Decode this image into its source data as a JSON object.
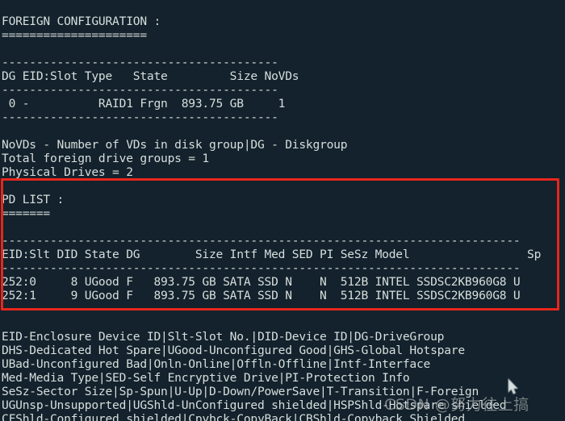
{
  "terminal": {
    "background_color": "#13222c",
    "text_color": "#d7dedd",
    "highlight_color": "#e8261c",
    "lines": [
      "FOREIGN CONFIGURATION :",
      "=====================",
      "",
      "----------------------------------------",
      "DG EID:Slot Type   State         Size NoVDs",
      "----------------------------------------",
      " 0 -          RAID1 Frgn  893.75 GB     1",
      "----------------------------------------",
      "",
      "NoVDs - Number of VDs in disk group|DG - Diskgroup",
      "Total foreign drive groups = 1",
      "Physical Drives = 2",
      "",
      "PD LIST :",
      "=======",
      "",
      "---------------------------------------------------------------------------",
      "EID:Slt DID State DG        Size Intf Med SED PI SeSz Model                 Sp",
      "---------------------------------------------------------------------------",
      "252:0     8 UGood F   893.75 GB SATA SSD N    N  512B INTEL SSDSC2KB960G8 U",
      "252:1     9 UGood F   893.75 GB SATA SSD N    N  512B INTEL SSDSC2KB960G8 U",
      "---------------------------------------------------------------------------",
      "",
      "EID-Enclosure Device ID|Slt-Slot No.|DID-Device ID|DG-DriveGroup",
      "DHS-Dedicated Hot Spare|UGood-Unconfigured Good|GHS-Global Hotspare",
      "UBad-Unconfigured Bad|Onln-Online|Offln-Offline|Intf-Interface",
      "Med-Media Type|SED-Self Encryptive Drive|PI-Protection Info",
      "SeSz-Sector Size|Sp-Spun|U-Up|D-Down/PowerSave|T-Transition|F-Foreign",
      "UGUnsp-Unsupported|UGShld-UnConfigured shielded|HSPShld-Hotspare shielded",
      "CFShld-Configured shielded|Cpybck-CopyBack|CBShld-Copyback Shielded"
    ]
  },
  "foreign_configuration": {
    "title": "FOREIGN CONFIGURATION :",
    "underline": "=====================",
    "columns": [
      "DG",
      "EID:Slot",
      "Type",
      "State",
      "Size",
      "NoVDs"
    ],
    "rows": [
      {
        "dg": "0",
        "eid_slot": "-",
        "type": "RAID1",
        "state": "Frgn",
        "size": "893.75 GB",
        "novds": "1"
      }
    ],
    "notes": [
      "NoVDs - Number of VDs in disk group|DG - Diskgroup",
      "Total foreign drive groups = 1",
      "Physical Drives = 2"
    ],
    "total_foreign_drive_groups": "1",
    "physical_drives": "2"
  },
  "pd_list": {
    "title": "PD LIST :",
    "underline": "=======",
    "columns": [
      "EID:Slt",
      "DID",
      "State",
      "DG",
      "Size",
      "Intf",
      "Med",
      "SED",
      "PI",
      "SeSz",
      "Model",
      "Sp"
    ],
    "rows": [
      {
        "eid_slt": "252:0",
        "did": "8",
        "state": "UGood",
        "dg": "F",
        "size": "893.75 GB",
        "intf": "SATA",
        "med": "SSD",
        "sed": "N",
        "pi": "N",
        "sesz": "512B",
        "model": "INTEL SSDSC2KB960G8",
        "sp": "U"
      },
      {
        "eid_slt": "252:1",
        "did": "9",
        "state": "UGood",
        "dg": "F",
        "size": "893.75 GB",
        "intf": "SATA",
        "med": "SSD",
        "sed": "N",
        "pi": "N",
        "sesz": "512B",
        "model": "INTEL SSDSC2KB960G8",
        "sp": "U"
      }
    ]
  },
  "legend": [
    "EID-Enclosure Device ID|Slt-Slot No.|DID-Device ID|DG-DriveGroup",
    "DHS-Dedicated Hot Spare|UGood-Unconfigured Good|GHS-Global Hotspare",
    "UBad-Unconfigured Bad|Onln-Online|Offln-Offline|Intf-Interface",
    "Med-Media Type|SED-Self Encryptive Drive|PI-Protection Info",
    "SeSz-Sector Size|Sp-Spun|U-Up|D-Down/PowerSave|T-Transition|F-Foreign",
    "UGUnsp-Unsupported|UGShld-UnConfigured shielded|HSPShld-Hotspare shielded",
    "CFShld-Configured shielded|Cpybck-CopyBack|CBShld-Copyback Shielded"
  ],
  "watermark": {
    "prefix": "CSDN @",
    "author": "努力往上搞"
  }
}
